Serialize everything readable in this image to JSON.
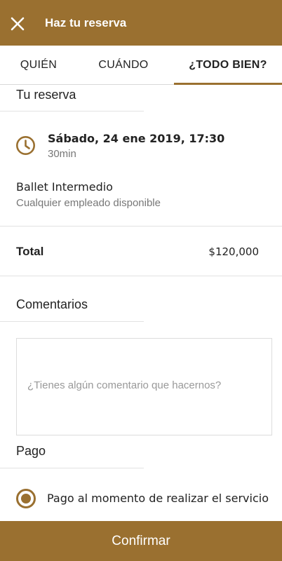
{
  "header": {
    "title": "Haz tu reserva",
    "close_icon": "close-icon",
    "color": "#9a7030"
  },
  "tabs": [
    {
      "label": "QUIÉN",
      "active": false
    },
    {
      "label": "CUÁNDO",
      "active": false
    },
    {
      "label": "¿TODO BIEN?",
      "active": true
    }
  ],
  "reservation": {
    "section_title": "Tu reserva",
    "clock_icon": "clock-icon",
    "date": "Sábado, 24 ene 2019, 17:30",
    "duration": "30min",
    "service": "Ballet Intermedio",
    "staff": "Cualquier empleado disponible"
  },
  "total": {
    "label": "Total",
    "value": "$120,000"
  },
  "comments": {
    "section_title": "Comentarios",
    "placeholder": "¿Tienes algún comentario que hacernos?"
  },
  "payment": {
    "section_title": "Pago",
    "option_label": "Pago al momento de realizar el servicio",
    "selected": true
  },
  "footer": {
    "confirm_label": "Confirmar"
  }
}
